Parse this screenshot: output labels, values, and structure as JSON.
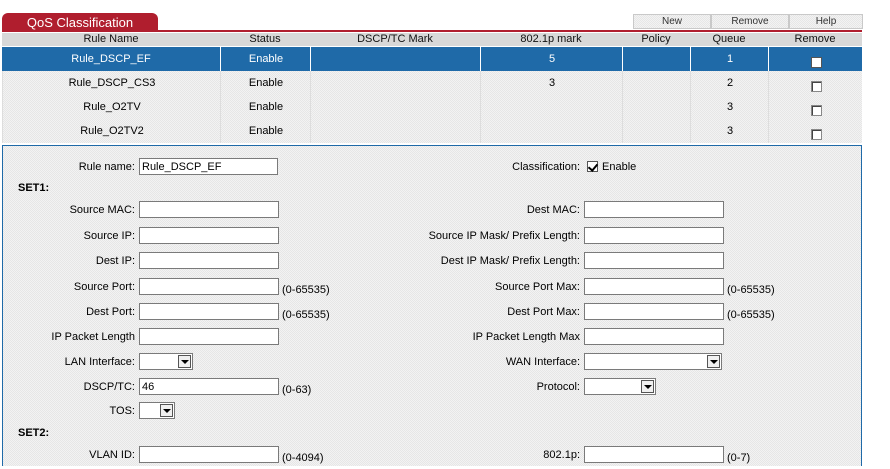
{
  "header": {
    "title": "QoS Classification",
    "buttons": {
      "new": "New",
      "remove": "Remove",
      "help": "Help"
    }
  },
  "table": {
    "columns": [
      "Rule Name",
      "Status",
      "DSCP/TC Mark",
      "802.1p mark",
      "Policy",
      "Queue",
      "Remove"
    ],
    "rows": [
      {
        "name": "Rule_DSCP_EF",
        "status": "Enable",
        "dscp": "",
        "p8021": "5",
        "policy": "",
        "queue": "1",
        "remove": false,
        "selected": true
      },
      {
        "name": "Rule_DSCP_CS3",
        "status": "Enable",
        "dscp": "",
        "p8021": "3",
        "policy": "",
        "queue": "2",
        "remove": false,
        "selected": false
      },
      {
        "name": "Rule_O2TV",
        "status": "Enable",
        "dscp": "",
        "p8021": "",
        "policy": "",
        "queue": "3",
        "remove": false,
        "selected": false
      },
      {
        "name": "Rule_O2TV2",
        "status": "Enable",
        "dscp": "",
        "p8021": "",
        "policy": "",
        "queue": "3",
        "remove": false,
        "selected": false
      }
    ]
  },
  "form": {
    "rule_name_label": "Rule name:",
    "rule_name_value": "Rule_DSCP_EF",
    "classification_label": "Classification:",
    "classification_enable": "Enable",
    "classification_checked": true,
    "set1": "SET1:",
    "set2": "SET2:",
    "source_mac": "Source MAC:",
    "dest_mac": "Dest MAC:",
    "source_ip": "Source IP:",
    "source_ip_mask": "Source IP Mask/ Prefix Length:",
    "dest_ip": "Dest IP:",
    "dest_ip_mask": "Dest IP Mask/ Prefix Length:",
    "source_port": "Source Port:",
    "source_port_max": "Source Port Max:",
    "dest_port": "Dest Port:",
    "dest_port_max": "Dest Port Max:",
    "port_range": "(0-65535)",
    "ip_packet_length": "IP Packet Length",
    "ip_packet_length_max": "IP Packet Length Max",
    "lan_interface": "LAN Interface:",
    "wan_interface": "WAN Interface:",
    "dscp_tc": "DSCP/TC:",
    "dscp_tc_value": "46",
    "dscp_range": "(0-63)",
    "protocol": "Protocol:",
    "tos": "TOS:",
    "vlan_id": "VLAN ID:",
    "vlan_range": "(0-4094)",
    "p8021": "802.1p:",
    "p8021_range": "(0-7)"
  },
  "colors": {
    "accent_red": "#b01e2e",
    "selection_blue": "#1f6aa8"
  }
}
